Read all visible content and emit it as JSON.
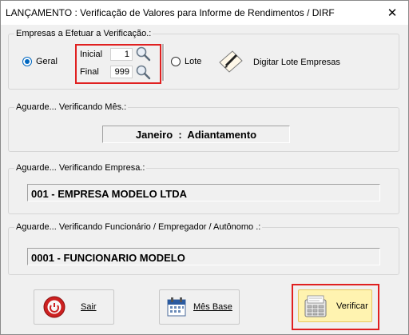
{
  "window": {
    "title": "LANÇAMENTO : Verificação de Valores para Informe de Rendimentos / DIRF",
    "close_glyph": "✕"
  },
  "empresas": {
    "legend": "Empresas a Efetuar a Verificação.:",
    "radio_geral": "Geral",
    "radio_lote": "Lote",
    "inicial_label": "Inicial",
    "inicial_value": "1",
    "final_label": "Final",
    "final_value": "999",
    "digitar_lote": "Digitar Lote Empresas",
    "selected": "Geral"
  },
  "mes": {
    "legend": "Aguarde... Verificando Mês.:",
    "value": "Janeiro  :  Adiantamento"
  },
  "empresa": {
    "legend": "Aguarde... Verificando Empresa.:",
    "value": "001 - EMPRESA MODELO LTDA"
  },
  "funcionario": {
    "legend": "Aguarde... Verificando Funcionário / Empregador / Autônomo .:",
    "value": "0001 - FUNCIONARIO MODELO"
  },
  "buttons": {
    "sair": "Sair",
    "mes_base": "Mês Base",
    "verificar": "Verificar"
  },
  "colors": {
    "highlight": "#e02020",
    "radio_selected": "#0067c0",
    "verificar_bg": "#fff3b0"
  }
}
